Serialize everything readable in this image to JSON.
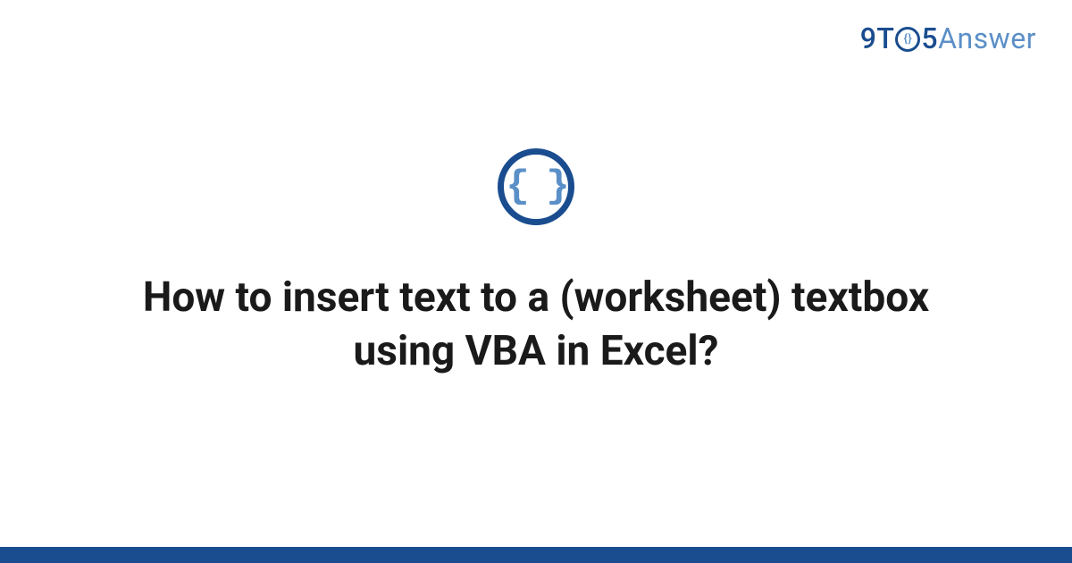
{
  "brand": {
    "part1": "9T",
    "o_inner": "{}",
    "part2": "5",
    "part3": "Answer"
  },
  "icon": {
    "name": "code-braces-icon",
    "glyph": "{ }"
  },
  "title": "How to insert text to a (worksheet) textbox using VBA in Excel?",
  "colors": {
    "primary": "#1a4d8f",
    "secondary": "#5b8fc7",
    "text": "#1a1a1a"
  }
}
